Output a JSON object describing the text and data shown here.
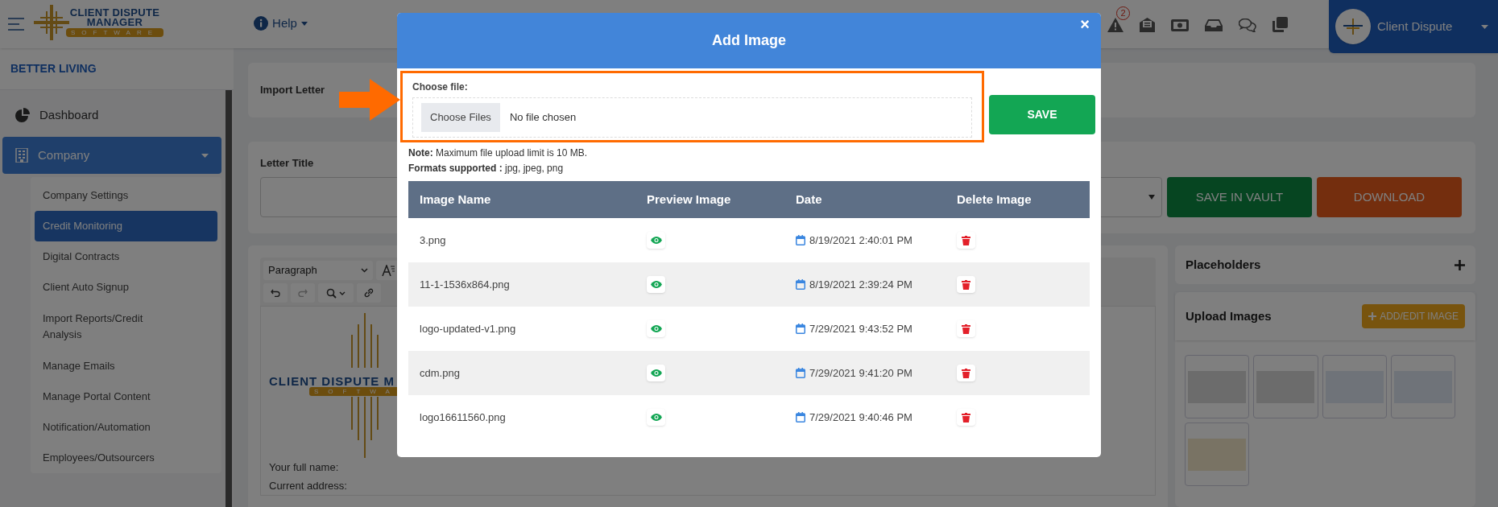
{
  "header": {
    "logo": {
      "line1": "CLIENT DISPUTE",
      "line2": "MANAGER",
      "tag": "SOFTWARE"
    },
    "help": "Help",
    "alert_badge": "2",
    "profile": "Client Dispute"
  },
  "sidebar": {
    "company": "BETTER LIVING",
    "items": [
      {
        "label": "Dashboard",
        "selected": false
      },
      {
        "label": "Company",
        "selected": true,
        "expanded": true,
        "children": [
          {
            "label": "Company Settings",
            "selected": false
          },
          {
            "label": "Credit Monitoring",
            "selected": true
          },
          {
            "label": "Digital Contracts",
            "selected": false
          },
          {
            "label": "Client Auto Signup",
            "selected": false
          },
          {
            "label": "Import Reports/Credit Analysis",
            "selected": false
          },
          {
            "label": "Manage Emails",
            "selected": false
          },
          {
            "label": "Manage Portal Content",
            "selected": false
          },
          {
            "label": "Notification/Automation",
            "selected": false
          },
          {
            "label": "Employees/Outsourcers",
            "selected": false
          }
        ]
      }
    ]
  },
  "main": {
    "import_label": "Import Letter",
    "title_label": "Letter Title",
    "buttons": [
      {
        "label": "SAVE IN VAULT",
        "kind": "save"
      },
      {
        "label": "DOWNLOAD",
        "kind": "download"
      }
    ],
    "editor": {
      "format": "Paragraph",
      "logo_text": "CLIENT DISPUTE M",
      "logo_tag": "SOFTWA",
      "lines": [
        "Your full name:",
        "Current address:"
      ]
    },
    "placeholders": "Placeholders",
    "upload_title": "Upload Images",
    "add_button": "ADD/EDIT IMAGE"
  },
  "modal": {
    "title": "Add Image",
    "close": "×",
    "file_label": "Choose file:",
    "file_button": "Choose Files",
    "file_status": "No file chosen",
    "save": "SAVE",
    "note": "**Note:** Maximum file upload limit is 10 MB.",
    "formats": "**Formats supported :** jpg, jpeg, png",
    "columns": [
      "Image Name",
      "Preview Image",
      "Date",
      "Delete Image"
    ],
    "rows": [
      {
        "name": "3.png",
        "date": "8/19/2021 2:40:01 PM"
      },
      {
        "name": "11-1-1536x864.png",
        "date": "8/19/2021 2:39:24 PM"
      },
      {
        "name": "logo-updated-v1.png",
        "date": "7/29/2021 9:43:52 PM"
      },
      {
        "name": "cdm.png",
        "date": "7/29/2021 9:41:20 PM"
      },
      {
        "name": "logo16611560.png",
        "date": "7/29/2021 9:40:46 PM"
      }
    ]
  }
}
